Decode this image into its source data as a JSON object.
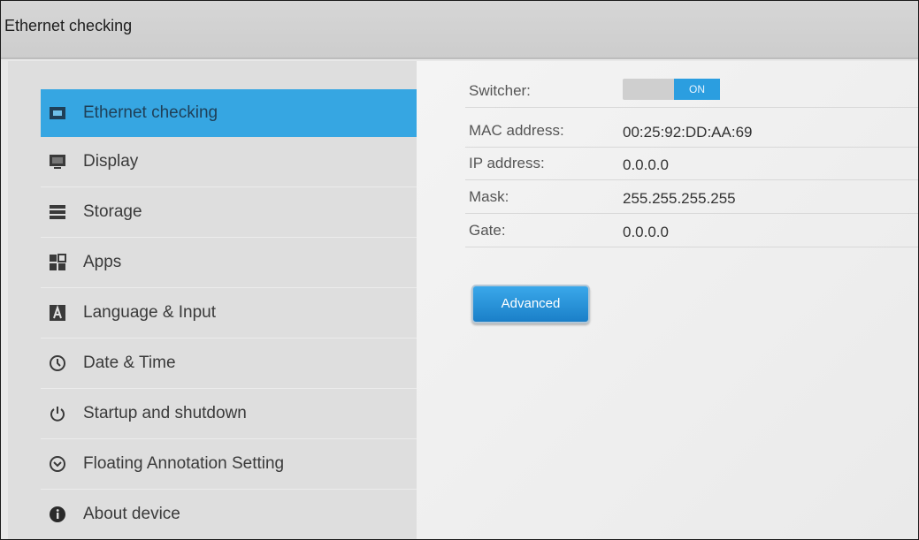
{
  "window": {
    "title": "Ethernet checking"
  },
  "sidebar": {
    "items": [
      {
        "label": "Ethernet checking",
        "icon": "ethernet-icon",
        "active": true
      },
      {
        "label": "Display",
        "icon": "display-icon"
      },
      {
        "label": "Storage",
        "icon": "storage-icon"
      },
      {
        "label": "Apps",
        "icon": "apps-icon"
      },
      {
        "label": "Language & Input",
        "icon": "language-icon"
      },
      {
        "label": "Date & Time",
        "icon": "clock-icon"
      },
      {
        "label": "Startup and shutdown",
        "icon": "power-icon"
      },
      {
        "label": "Floating Annotation Setting",
        "icon": "chevron-circle-icon"
      },
      {
        "label": "About device",
        "icon": "info-icon"
      }
    ]
  },
  "details": {
    "switcher": {
      "label": "Switcher:",
      "state": "ON"
    },
    "mac": {
      "label": "MAC address:",
      "value": "00:25:92:DD:AA:69"
    },
    "ip": {
      "label": "IP address:",
      "value": "0.0.0.0"
    },
    "mask": {
      "label": "Mask:",
      "value": "255.255.255.255"
    },
    "gate": {
      "label": "Gate:",
      "value": "0.0.0.0"
    }
  },
  "actions": {
    "advanced_label": "Advanced"
  },
  "colors": {
    "accent": "#36a6e2",
    "toggle_on": "#2b9ee0",
    "button": "#2390d8"
  }
}
